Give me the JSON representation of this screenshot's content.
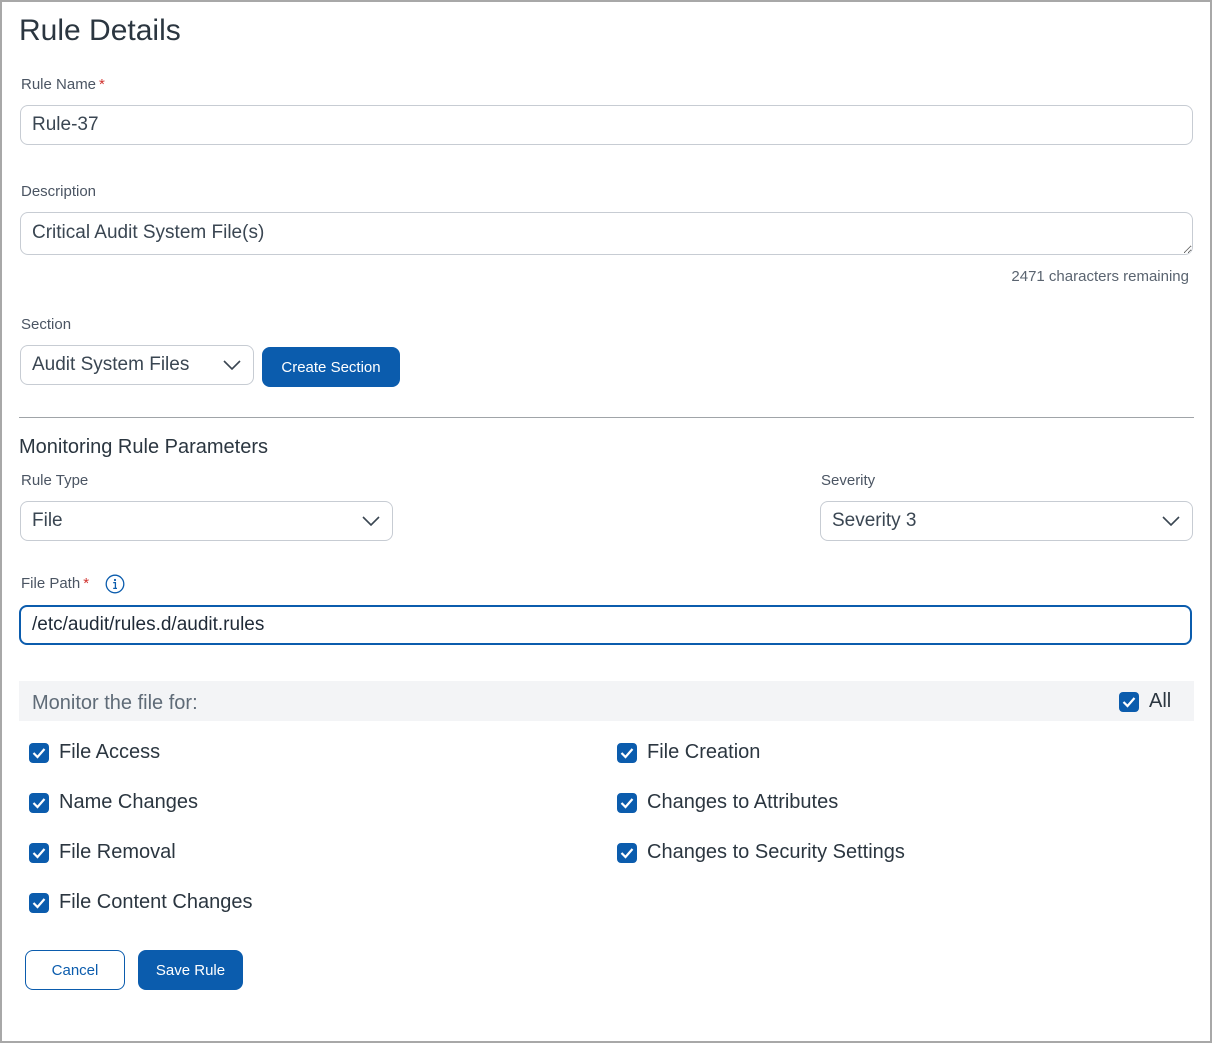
{
  "page": {
    "title": "Rule Details"
  },
  "rule_name": {
    "label": "Rule Name",
    "required_mark": "*",
    "value": "Rule-37"
  },
  "description": {
    "label": "Description",
    "value": "Critical Audit System File(s)",
    "counter": "2471 characters remaining"
  },
  "section": {
    "label": "Section",
    "selected": "Audit System Files",
    "create_button": "Create Section"
  },
  "monitoring": {
    "title": "Monitoring Rule Parameters",
    "rule_type": {
      "label": "Rule Type",
      "selected": "File"
    },
    "severity": {
      "label": "Severity",
      "selected": "Severity 3"
    },
    "file_path": {
      "label": "File Path",
      "required_mark": "*",
      "value": "/etc/audit/rules.d/audit.rules",
      "info_icon": "info-icon"
    }
  },
  "monitor_for": {
    "label": "Monitor the file for:",
    "all": {
      "label": "All",
      "checked": true
    },
    "left": [
      {
        "label": "File Access",
        "checked": true
      },
      {
        "label": "Name Changes",
        "checked": true
      },
      {
        "label": "File Removal",
        "checked": true
      },
      {
        "label": "File Content Changes",
        "checked": true
      }
    ],
    "right": [
      {
        "label": "File Creation",
        "checked": true
      },
      {
        "label": "Changes to Attributes",
        "checked": true
      },
      {
        "label": "Changes to Security Settings",
        "checked": true
      }
    ]
  },
  "actions": {
    "cancel": "Cancel",
    "save": "Save Rule"
  },
  "colors": {
    "primary": "#0b5cad",
    "required": "#d0312d",
    "focus_border": "#0b5cad"
  }
}
